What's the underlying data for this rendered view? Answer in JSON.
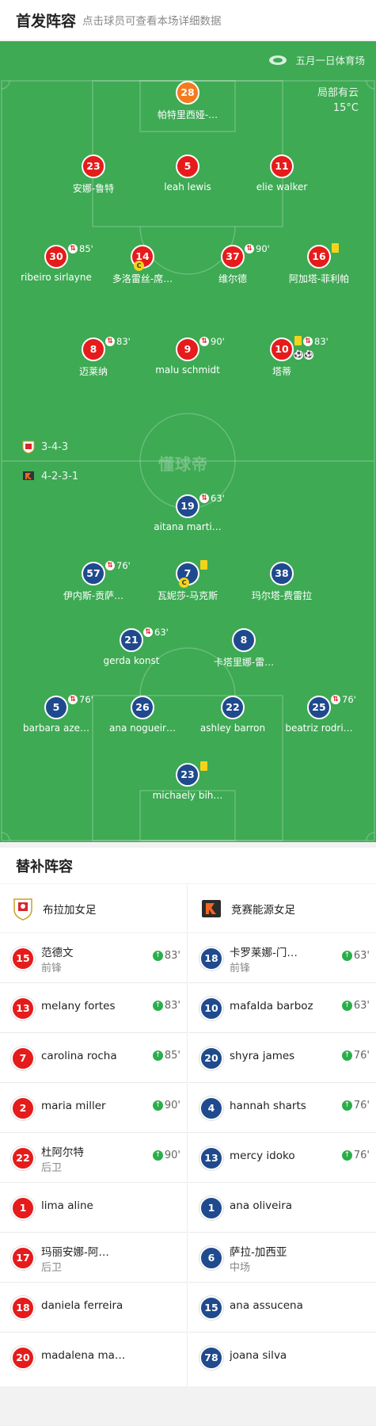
{
  "header": {
    "title": "首发阵容",
    "subtitle": "点击球员可查看本场详细数据"
  },
  "venue": {
    "name": "五月一日体育场",
    "icon": "stadium-icon"
  },
  "weather": {
    "condition": "局部有云",
    "temperature": "15°C"
  },
  "watermark": "懂球帝",
  "formations": {
    "home": "3-4-3",
    "away": "4-2-3-1"
  },
  "home_players": [
    {
      "number": "28",
      "name": "帕特里西娅-…",
      "color": "orange"
    },
    {
      "number": "23",
      "name": "安娜-鲁特",
      "color": "red"
    },
    {
      "number": "5",
      "name": "leah lewis",
      "color": "red"
    },
    {
      "number": "11",
      "name": "elie walker",
      "color": "red"
    },
    {
      "number": "30",
      "name": "ribeiro sirlayne",
      "color": "red",
      "sub": "85'"
    },
    {
      "number": "14",
      "name": "多洛雷丝-席…",
      "color": "red",
      "captain": "C"
    },
    {
      "number": "37",
      "name": "维尔德",
      "color": "red",
      "sub": "90'"
    },
    {
      "number": "16",
      "name": "阿加塔-菲利帕",
      "color": "red",
      "card": "yellow"
    },
    {
      "number": "8",
      "name": "迈莱纳",
      "color": "red",
      "sub": "83'"
    },
    {
      "number": "9",
      "name": "malu schmidt",
      "color": "red",
      "sub": "90'"
    },
    {
      "number": "10",
      "name": "塔蒂",
      "color": "red",
      "sub": "83'",
      "card": "yellow",
      "goals": 2
    }
  ],
  "away_players": [
    {
      "number": "19",
      "name": "aitana marti…",
      "color": "blue",
      "sub": "63'"
    },
    {
      "number": "57",
      "name": "伊内斯-贡萨…",
      "color": "blue",
      "sub": "76'"
    },
    {
      "number": "7",
      "name": "瓦妮莎-马克斯",
      "color": "blue",
      "captain": "C",
      "card": "yellow"
    },
    {
      "number": "38",
      "name": "玛尔塔-费雷拉",
      "color": "blue"
    },
    {
      "number": "21",
      "name": "gerda konst",
      "color": "blue",
      "sub": "63'"
    },
    {
      "number": "8",
      "name": "卡塔里娜-雷…",
      "color": "blue"
    },
    {
      "number": "5",
      "name": "barbara aze…",
      "color": "blue",
      "sub": "76'"
    },
    {
      "number": "26",
      "name": "ana nogueir…",
      "color": "blue"
    },
    {
      "number": "22",
      "name": "ashley barron",
      "color": "blue"
    },
    {
      "number": "25",
      "name": "beatriz rodri…",
      "color": "blue",
      "sub": "76'"
    },
    {
      "number": "23",
      "name": "michaely bih…",
      "color": "blue",
      "card": "yellow"
    }
  ],
  "subs_title": "替补阵容",
  "home_team": {
    "name": "布拉加女足",
    "subs": [
      {
        "number": "15",
        "name": "范德文",
        "pos": "前锋",
        "min": "83'"
      },
      {
        "number": "13",
        "name": "melany fortes",
        "pos": "",
        "min": "83'"
      },
      {
        "number": "7",
        "name": "carolina rocha",
        "pos": "",
        "min": "85'"
      },
      {
        "number": "2",
        "name": "maria miller",
        "pos": "",
        "min": "90'"
      },
      {
        "number": "22",
        "name": "杜阿尔特",
        "pos": "后卫",
        "min": "90'"
      },
      {
        "number": "1",
        "name": "lima aline",
        "pos": "",
        "min": ""
      },
      {
        "number": "17",
        "name": "玛丽安娜-阿…",
        "pos": "后卫",
        "min": ""
      },
      {
        "number": "18",
        "name": "daniela ferreira",
        "pos": "",
        "min": ""
      },
      {
        "number": "20",
        "name": "madalena ma…",
        "pos": "",
        "min": ""
      }
    ]
  },
  "away_team": {
    "name": "竞赛能源女足",
    "subs": [
      {
        "number": "18",
        "name": "卡罗莱娜-门…",
        "pos": "前锋",
        "min": "63'"
      },
      {
        "number": "10",
        "name": "mafalda barboz",
        "pos": "",
        "min": "63'"
      },
      {
        "number": "20",
        "name": "shyra james",
        "pos": "",
        "min": "76'"
      },
      {
        "number": "4",
        "name": "hannah sharts",
        "pos": "",
        "min": "76'"
      },
      {
        "number": "13",
        "name": "mercy idoko",
        "pos": "",
        "min": "76'"
      },
      {
        "number": "1",
        "name": "ana oliveira",
        "pos": "",
        "min": ""
      },
      {
        "number": "6",
        "name": "萨拉-加西亚",
        "pos": "中场",
        "min": ""
      },
      {
        "number": "15",
        "name": "ana assucena",
        "pos": "",
        "min": ""
      },
      {
        "number": "78",
        "name": "joana silva",
        "pos": "",
        "min": ""
      }
    ]
  },
  "colors": {
    "pitch": "#3eaa54",
    "home": "#e61b1b",
    "away": "#1f4a8e",
    "keeper_home": "#f47a1f",
    "card": "#f5d31b",
    "sub_arrow": "#2aae4a"
  }
}
